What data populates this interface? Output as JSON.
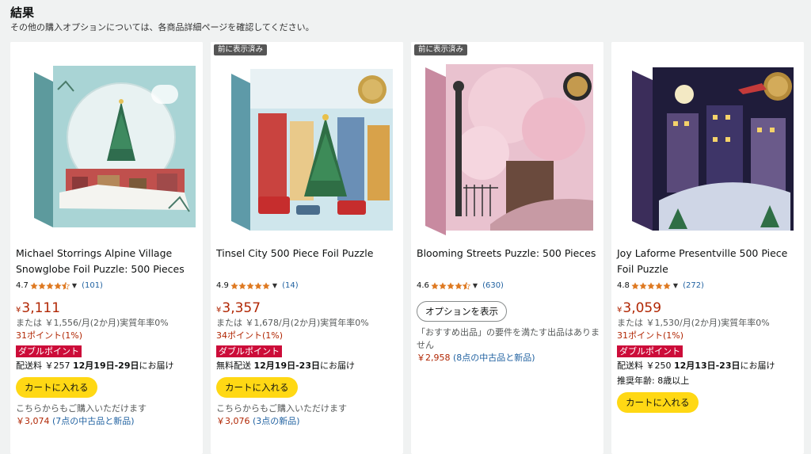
{
  "header": {
    "title": "結果",
    "subtitle": "その他の購入オプションについては、各商品詳細ページを確認してください。"
  },
  "products": [
    {
      "title": "Michael Storrings Alpine Village Snowglobe Foil Puzzle: 500 Pieces",
      "rating": "4.7",
      "reviews": "(101)",
      "price_symbol": "¥",
      "price": "3,111",
      "installment": "または ￥1,556/月(2か月)実質年率0%",
      "points": "31ポイント(1%)",
      "double_points": "ダブルポイント",
      "shipping_prefix": "配送料 ￥257 ",
      "shipping_date": "12月19日-29日",
      "shipping_suffix": "にお届け",
      "cart": "カートに入れる",
      "also_buy": "こちらからもご購入いただけます",
      "used_price": "￥3,074",
      "used_link": "(7点の中古品と新品)"
    },
    {
      "badge": "前に表示済み",
      "title": "Tinsel City 500 Piece Foil Puzzle",
      "rating": "4.9",
      "reviews": "(14)",
      "price_symbol": "¥",
      "price": "3,357",
      "installment": "または ￥1,678/月(2か月)実質年率0%",
      "points": "34ポイント(1%)",
      "double_points": "ダブルポイント",
      "shipping_prefix": "無料配送 ",
      "shipping_date": "12月19日-23日",
      "shipping_suffix": "にお届け",
      "cart": "カートに入れる",
      "also_buy": "こちらからもご購入いただけます",
      "used_price": "￥3,076",
      "used_link": "(3点の新品)"
    },
    {
      "badge": "前に表示済み",
      "title": "Blooming Streets Puzzle: 500 Pieces",
      "rating": "4.6",
      "reviews": "(630)",
      "option_button": "オプションを表示",
      "note": "「おすすめ出品」の要件を満たす出品はありません",
      "used_price": "￥2,958",
      "used_link": "(8点の中古品と新品)"
    },
    {
      "title": "Joy Laforme Presentville 500 Piece Foil Puzzle",
      "rating": "4.8",
      "reviews": "(272)",
      "price_symbol": "¥",
      "price": "3,059",
      "installment": "または ￥1,530/月(2か月)実質年率0%",
      "points": "31ポイント(1%)",
      "double_points": "ダブルポイント",
      "shipping_prefix": "配送料 ￥250 ",
      "shipping_date": "12月13日-23日",
      "shipping_suffix": "にお届け",
      "age": "推奨年齢: 8歳以上",
      "cart": "カートに入れる"
    }
  ],
  "colors": {
    "price": "#b12704",
    "link": "#2162a1",
    "cart_button": "#ffd814",
    "double_points_bg": "#cc0c39",
    "star": "#de7921"
  }
}
